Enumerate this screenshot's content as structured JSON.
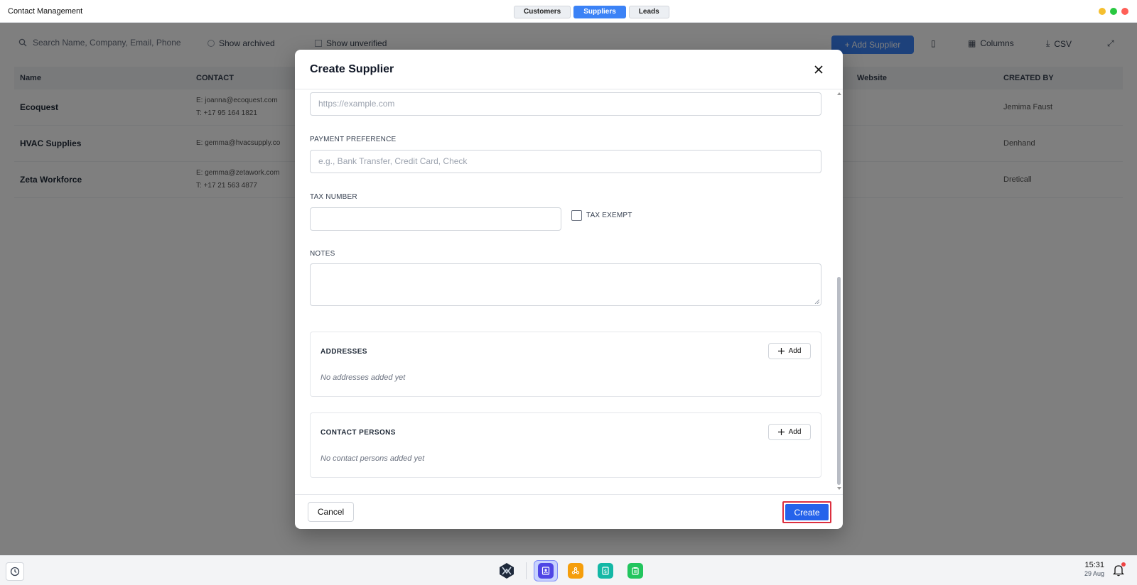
{
  "window": {
    "title": "Contact Management",
    "tabs": [
      {
        "label": "Customers",
        "active": false
      },
      {
        "label": "Suppliers",
        "active": true
      },
      {
        "label": "Leads",
        "active": false
      }
    ],
    "controls": {
      "minimize_color": "#f5bf2f",
      "maximize_color": "#28c840",
      "close_color": "#ff5f57"
    }
  },
  "background_app": {
    "search_placeholder": "Search Name, Company, Email, Phone",
    "filters": [
      "Show archived",
      "Show unverified"
    ],
    "primary_action": "+ Add Supplier",
    "actions": [
      "Columns",
      "CSV"
    ],
    "table": {
      "headers": [
        "Name",
        "CONTACT",
        "Website",
        "CREATED BY"
      ],
      "rows": [
        {
          "name": "Ecoquest",
          "contact_email": "E: joanna@ecoquest.com",
          "contact_phone": "T: +17 95 164 1821",
          "created_by": "Jemima Faust"
        },
        {
          "name": "HVAC Supplies",
          "contact_email": "E: gemma@hvacsupply.co",
          "contact_phone": "",
          "created_by": "Denhand"
        },
        {
          "name": "Zeta Workforce",
          "contact_email": "E: gemma@zetawork.com",
          "contact_phone": "T: +17 21 563 4877",
          "created_by": "Dreticall"
        }
      ]
    }
  },
  "modal": {
    "title": "Create Supplier",
    "website_placeholder": "https://example.com",
    "payment_label": "PAYMENT PREFERENCE",
    "payment_placeholder": "e.g., Bank Transfer, Credit Card, Check",
    "tax_label": "TAX NUMBER",
    "tax_value": "",
    "tax_exempt_label": "TAX EXEMPT",
    "tax_exempt_checked": false,
    "notes_label": "NOTES",
    "notes_value": "",
    "addresses": {
      "title": "ADDRESSES",
      "add_label": "Add",
      "empty_text": "No addresses added yet"
    },
    "contacts": {
      "title": "CONTACT PERSONS",
      "add_label": "Add",
      "empty_text": "No contact persons added yet"
    },
    "cancel_label": "Cancel",
    "create_label": "Create"
  },
  "taskbar": {
    "time": "15:31",
    "date": "29 Aug",
    "apps": [
      "contacts-app",
      "network-app",
      "spreadsheet-app",
      "clipboard-app"
    ],
    "app_colors": {
      "contacts": "#4f46e5",
      "network": "#f59e0b",
      "spreadsheet": "#14b8a6",
      "clipboard": "#22c55e"
    }
  }
}
